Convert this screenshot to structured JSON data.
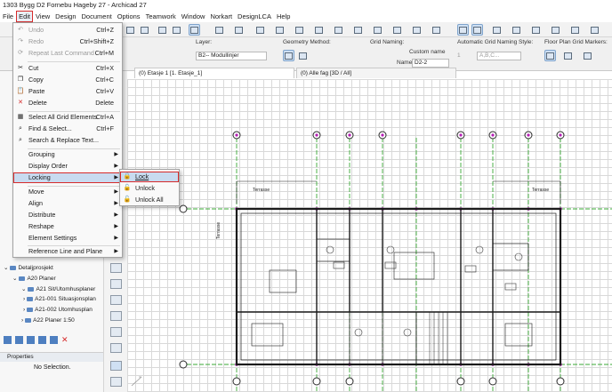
{
  "window": {
    "title": "1303 Bygg D2 Fornebu Hageby 27 - Archicad 27"
  },
  "menubar": {
    "items": [
      "File",
      "Edit",
      "View",
      "Design",
      "Document",
      "Options",
      "Teamwork",
      "Window",
      "Norkart",
      "DesignLCA",
      "Help"
    ]
  },
  "infobox": {
    "layer_label": "Layer:",
    "layer_value": "B2-- Modullinjer",
    "geometry_label": "Geometry Method:",
    "grid_naming_label": "Grid Naming:",
    "custom_name": "Custom name",
    "name_label": "Name:",
    "name_value": "D2-2",
    "auto_naming_label": "Automatic Grid Naming Style:",
    "auto_naming_value": "A,B,C...",
    "auto_naming_num": "1",
    "floor_markers_label": "Floor Plan Grid Markers:"
  },
  "tabs": {
    "tab1": "(0) Etasje 1 [1. Etasje_1]",
    "tab2": "(0) Alle fag [3D / All]"
  },
  "edit_menu": {
    "items": [
      {
        "label": "Undo",
        "shortcut": "Ctrl+Z",
        "disabled": true
      },
      {
        "label": "Redo",
        "shortcut": "Ctrl+Shift+Z",
        "disabled": true
      },
      {
        "label": "Repeat Last Command",
        "shortcut": "Ctrl+M",
        "disabled": true
      },
      {
        "label": "Cut",
        "shortcut": "Ctrl+X"
      },
      {
        "label": "Copy",
        "shortcut": "Ctrl+C"
      },
      {
        "label": "Paste",
        "shortcut": "Ctrl+V"
      },
      {
        "label": "Delete",
        "shortcut": "Delete"
      },
      {
        "label": "Select All Grid Elements",
        "shortcut": "Ctrl+A"
      },
      {
        "label": "Find & Select...",
        "shortcut": "Ctrl+F"
      },
      {
        "label": "Search & Replace Text..."
      },
      {
        "label": "Grouping"
      },
      {
        "label": "Display Order"
      },
      {
        "label": "Locking"
      },
      {
        "label": "Move"
      },
      {
        "label": "Align"
      },
      {
        "label": "Distribute"
      },
      {
        "label": "Reshape"
      },
      {
        "label": "Element Settings"
      },
      {
        "label": "Reference Line and Plane"
      }
    ]
  },
  "locking_submenu": {
    "items": [
      "Lock",
      "Unlock",
      "Unlock All"
    ]
  },
  "navigator": {
    "items": [
      "Detaljprosjekt",
      "A20 Planer",
      "A21 Sit/Utomhusplaner",
      "A21-001 Situasjonsplan",
      "A21-002 Utomhusplan",
      "A22 Planer 1:50"
    ]
  },
  "properties": {
    "header": "Properties",
    "selection": "No Selection."
  },
  "plan": {
    "labels": [
      "Terrasse",
      "Terrasse",
      "Terrasse"
    ]
  }
}
